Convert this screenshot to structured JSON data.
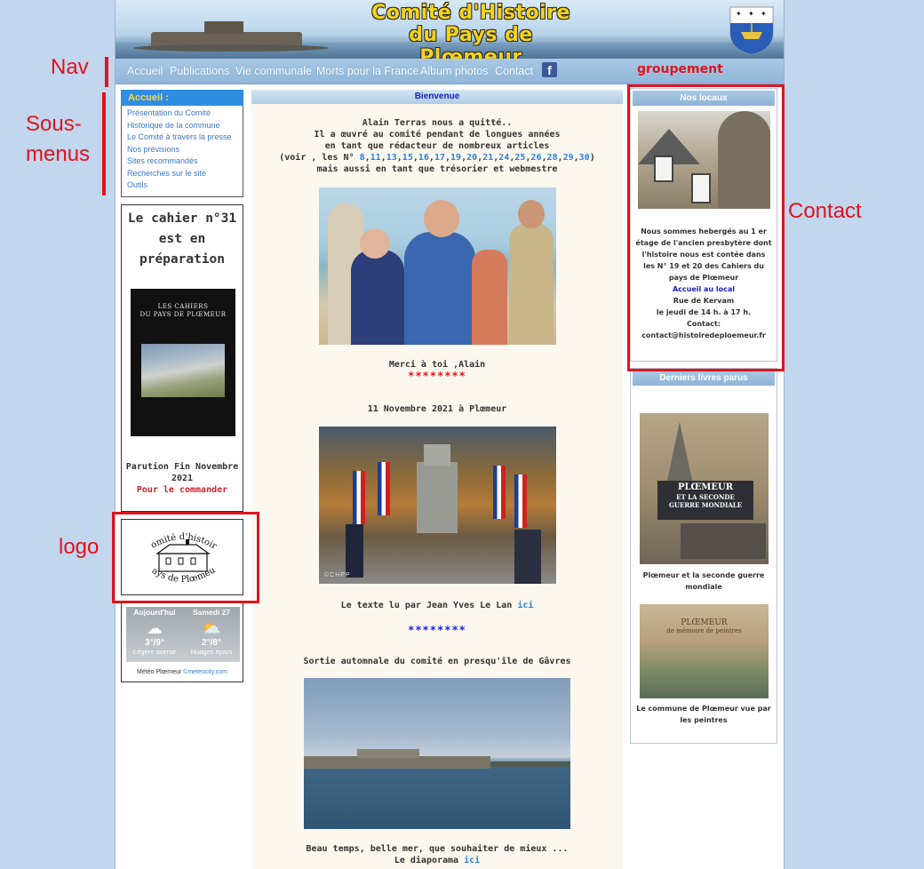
{
  "banner": {
    "title_line1": "Comité d'Histoire",
    "title_line2": "du Pays de Plœmeur"
  },
  "nav": {
    "items": [
      "Accueil",
      "Publications",
      "Vie communale",
      "Morts pour la France",
      "Album photos",
      "Contact"
    ],
    "facebook_icon": "facebook-icon"
  },
  "sidebar": {
    "header": "Accueil :",
    "items": [
      "Présentation du Comité",
      "Historique de la commune",
      "Le Comité à travers la presse",
      "Nos prévisions",
      "Sites recommandés",
      "Recherches sur le site",
      "Outils"
    ]
  },
  "cahier": {
    "title_line1": "Le cahier n°31",
    "title_line2": "est en",
    "title_line3": "préparation",
    "cover_title_line1": "LES CAHIERS",
    "cover_title_line2": "DU PAYS DE PLŒMEUR",
    "parution_line1": "Parution Fin Novembre",
    "parution_line2": "2021",
    "order_link": "Pour le commander"
  },
  "logo": {
    "line1": "Comité d'histoire",
    "line2": "Pays de Plœmeur"
  },
  "weather": {
    "day1": {
      "label": "Aujourd'hui",
      "temp": "3°/9°",
      "cond": "Légère averse"
    },
    "day2": {
      "label": "Samedi 27",
      "temp": "2°/8°",
      "cond": "Nuages épars"
    },
    "credit_prefix": "Météo Plœmeur ",
    "credit_link": "©meteocity.com"
  },
  "center": {
    "header": "Bienvenue",
    "intro_line1": "Alain Terras nous a quitté..",
    "intro_line2": "Il a œuvré au comité pendant de longues années",
    "intro_line3": "en tant que rédacteur de nombreux articles",
    "intro_voir": "(voir , les N°",
    "intro_numbers": [
      "8",
      "11",
      "13",
      "15",
      "16",
      "17",
      "19",
      "20",
      "21",
      "24",
      "25",
      "26",
      "28",
      "29",
      "30"
    ],
    "intro_line5": "mais aussi en tant que trésorier et webmestre",
    "merci": "Merci à toi ,Alain",
    "stars_red": "********",
    "nov_title": "11 Novembre 2021 à Plœmeur",
    "photo_credit": "©CHPP",
    "texte_lu": "Le texte lu par Jean Yves Le Lan",
    "ici": "ici",
    "stars_blue": "********",
    "sortie": "Sortie automnale du comité en presqu'île de Gâvres",
    "beau_temps": "Beau temps, belle mer, que souhaiter de mieux ...",
    "diaporama": "Le diaporama"
  },
  "right": {
    "locaux_header": "Nos locaux",
    "locaux_text1": "Nous sommes hebergés au 1 er",
    "locaux_text2": "étage de l'ancien presbytère dont",
    "locaux_text3": "l'histoire nous est contée dans",
    "locaux_text4": "les N° 19 et 20 des Cahiers du",
    "locaux_text5": "pays de Plœmeur",
    "accueil_link": "Accueil au local",
    "rue": "Rue de Kervam",
    "horaires": "le jeudi de 14 h. à 17 h.",
    "contact_label": "Contact:",
    "email": "contact@histoiredeploemeur.fr",
    "livres_header": "Derniers livres parus",
    "book1_title_line1": "PLŒMEUR",
    "book1_title_line2": "ET LA SECONDE",
    "book1_title_line3": "GUERRE MONDIALE",
    "book1_caption": "Plœmeur et la seconde guerre mondiale",
    "book2_title_line1": "PLŒMEUR",
    "book2_title_line2": "de mémoire de peintres",
    "book2_caption": "Le commune de Plœmeur vue par les peintres"
  },
  "annotations": {
    "nav": "Nav",
    "sous_menus_1": "Sous-",
    "sous_menus_2": "menus",
    "logo": "logo",
    "contact": "Contact",
    "groupement": "groupement"
  },
  "colors": {
    "background": "#c2d6ee",
    "nav": "#9cc0e0",
    "sidebar_header": "#2f8de4",
    "annotation": "#e0141e",
    "link": "#2b82d9"
  }
}
